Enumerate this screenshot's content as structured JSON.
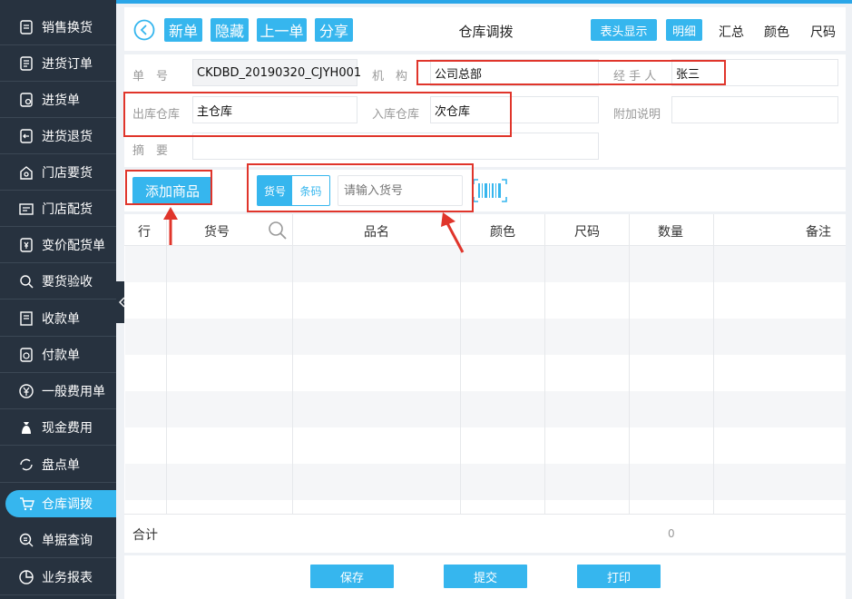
{
  "sidebar": {
    "items": [
      {
        "label": "销售换货",
        "icon": "exchange-icon"
      },
      {
        "label": "进货订单",
        "icon": "purchase-order-icon"
      },
      {
        "label": "进货单",
        "icon": "purchase-icon"
      },
      {
        "label": "进货退货",
        "icon": "return-icon"
      },
      {
        "label": "门店要货",
        "icon": "store-request-icon"
      },
      {
        "label": "门店配货",
        "icon": "store-distribute-icon"
      },
      {
        "label": "变价配货单",
        "icon": "price-change-icon"
      },
      {
        "label": "要货验收",
        "icon": "inspect-icon"
      },
      {
        "label": "收款单",
        "icon": "receipt-icon"
      },
      {
        "label": "付款单",
        "icon": "payment-icon"
      },
      {
        "label": "一般费用单",
        "icon": "yen-icon"
      },
      {
        "label": "现金费用",
        "icon": "cash-bag-icon"
      },
      {
        "label": "盘点单",
        "icon": "stocktake-icon"
      },
      {
        "label": "仓库调拨",
        "icon": "cart-icon"
      },
      {
        "label": "单据查询",
        "icon": "search-doc-icon"
      },
      {
        "label": "业务报表",
        "icon": "report-icon"
      }
    ],
    "active_index": 13
  },
  "toolbar": {
    "new": "新单",
    "hide": "隐藏",
    "prev": "上一单",
    "share": "分享",
    "title": "仓库调拨",
    "header_display": "表头显示",
    "detail": "明细",
    "summary": "汇总",
    "color": "颜色",
    "size": "尺码"
  },
  "form": {
    "doc_no_label": "单　号",
    "doc_no_value": "CKDBD_20190320_CJYH001",
    "org_label": "机　构",
    "org_value": "公司总部",
    "handler_label": "经 手 人",
    "handler_value": "张三",
    "out_wh_label": "出库仓库",
    "out_wh_value": "主仓库",
    "in_wh_label": "入库仓库",
    "in_wh_value": "次仓库",
    "extra_label": "附加说明",
    "extra_value": "",
    "memo_label": "摘　要",
    "memo_value": ""
  },
  "entry": {
    "add_product": "添加商品",
    "mode_item": "货号",
    "mode_barcode": "条码",
    "input_placeholder": "请输入货号"
  },
  "table": {
    "columns": [
      "行",
      "货号",
      "品名",
      "颜色",
      "尺码",
      "数量",
      "备注"
    ],
    "rows": [],
    "total_label": "合计",
    "total_qty": "0"
  },
  "footer": {
    "save": "保存",
    "submit": "提交",
    "print": "打印"
  },
  "colors": {
    "accent": "#36b6ee",
    "sidebar_bg": "#27323f",
    "annotation_red": "#e0352b"
  }
}
